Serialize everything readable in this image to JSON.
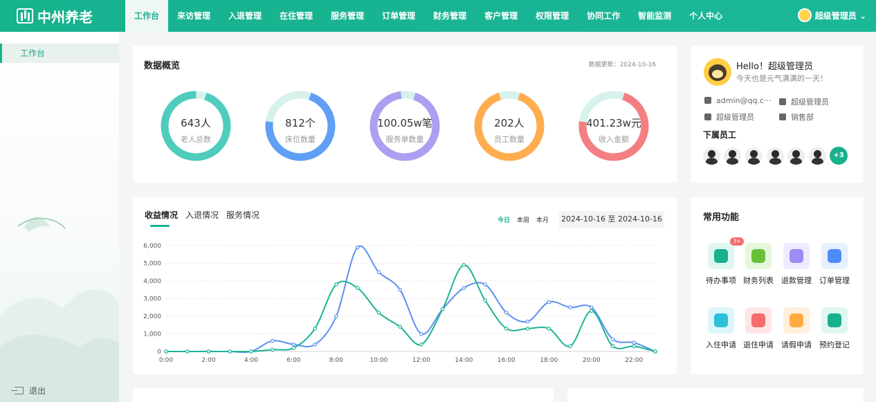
{
  "app": {
    "name": "中州养老"
  },
  "nav": [
    "工作台",
    "来访管理",
    "入退管理",
    "在住管理",
    "服务管理",
    "订单管理",
    "财务管理",
    "客户管理",
    "权限管理",
    "协同工作",
    "智能监测",
    "个人中心"
  ],
  "user": {
    "name": "超级管理员 ⌄"
  },
  "sidebar": {
    "active": "工作台",
    "logout": "退出"
  },
  "overview": {
    "title": "数据概览",
    "update": "数据更新：2024-10-16",
    "items": [
      {
        "value": "643人",
        "label": "老人总数",
        "color": "#4ecdbd",
        "percent": 0.95
      },
      {
        "value": "812个",
        "label": "床位数量",
        "color": "#5f9ff6",
        "percent": 0.72
      },
      {
        "value": "100.05w笔",
        "label": "服务单数量",
        "color": "#aa9ff0",
        "percent": 0.93
      },
      {
        "value": "202人",
        "label": "员工数量",
        "color": "#ffad4f",
        "percent": 0.9
      },
      {
        "value": "401.23w元",
        "label": "收入金额",
        "color": "#f47e82",
        "percent": 0.72
      }
    ]
  },
  "income": {
    "tabs": [
      "收益情况",
      "入退情况",
      "服务情况"
    ],
    "ranges": [
      "今日",
      "本周",
      "本月"
    ],
    "date_range": "2024-10-16 至 2024-10-16"
  },
  "profile": {
    "hello": "Hello！超级管理员",
    "subtitle": "今天也是元气满满的一天！",
    "email": "admin@qq.c···",
    "role1": "超级管理员",
    "org": "超级管理员",
    "dept": "销售部",
    "employees_title": "下属员工",
    "more": "+3"
  },
  "functions": {
    "title": "常用功能",
    "items": [
      {
        "label": "待办事项",
        "color": "#18b08d",
        "bg": "#dff7f0",
        "badge": "3+"
      },
      {
        "label": "财务列表",
        "color": "#67c23a",
        "bg": "#e7f7dc"
      },
      {
        "label": "退款管理",
        "color": "#9b8df2",
        "bg": "#eeeaff"
      },
      {
        "label": "订单管理",
        "color": "#4e8df5",
        "bg": "#e6f0ff"
      },
      {
        "label": "入住申请",
        "color": "#2cc1d8",
        "bg": "#dcf7fb"
      },
      {
        "label": "退住申请",
        "color": "#f56c6c",
        "bg": "#ffe5e5"
      },
      {
        "label": "请假申请",
        "color": "#ffab42",
        "bg": "#fff0dc"
      },
      {
        "label": "预约登记",
        "color": "#18b08d",
        "bg": "#dff7f0"
      }
    ]
  },
  "chart_data": {
    "type": "line",
    "x": [
      "0:00",
      "1:00",
      "2:00",
      "3:00",
      "4:00",
      "5:00",
      "6:00",
      "7:00",
      "8:00",
      "9:00",
      "10:00",
      "11:00",
      "12:00",
      "13:00",
      "14:00",
      "15:00",
      "16:00",
      "17:00",
      "18:00",
      "19:00",
      "20:00",
      "21:00",
      "22:00",
      "23:00"
    ],
    "x_ticks": [
      "0:00",
      "2:00",
      "4:00",
      "6:00",
      "8:00",
      "10:00",
      "12:00",
      "14:00",
      "16:00",
      "18:00",
      "20:00",
      "22:00"
    ],
    "y_ticks": [
      "0",
      "1,000",
      "2,000",
      "3,000",
      "4,000",
      "5,000",
      "6,000"
    ],
    "ylim": [
      0,
      6000
    ],
    "grid": true,
    "series": [
      {
        "values": [
          0,
          0,
          0,
          0,
          0,
          600,
          400,
          400,
          2000,
          5900,
          4500,
          3500,
          1000,
          2400,
          3600,
          3800,
          2200,
          1700,
          2800,
          2500,
          2500,
          700,
          500,
          0
        ],
        "color": "#5b8ff4"
      },
      {
        "values": [
          0,
          0,
          0,
          0,
          0,
          100,
          200,
          1300,
          3800,
          3600,
          2200,
          1400,
          400,
          2400,
          4900,
          2900,
          1300,
          1300,
          1300,
          300,
          2300,
          300,
          300,
          0
        ],
        "color": "#1ab394"
      }
    ]
  }
}
